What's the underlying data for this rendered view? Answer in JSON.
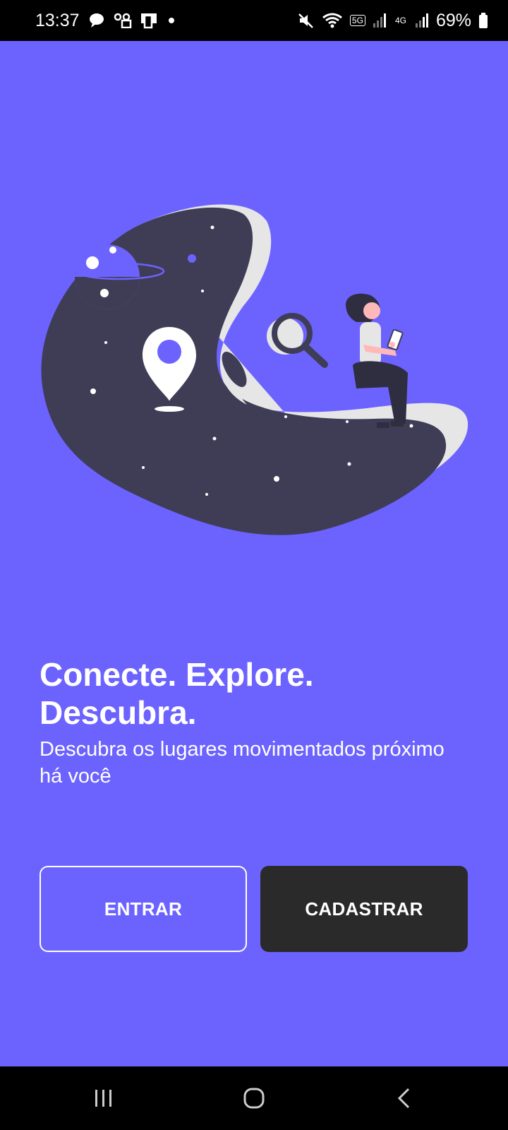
{
  "status_bar": {
    "time": "13:37",
    "battery_percent": "69%",
    "network_5g": "5G",
    "network_4g": "4G",
    "icons": [
      "chat-icon",
      "voicemail-icon",
      "screen-icon",
      "dot-icon",
      "mute-icon",
      "wifi-icon",
      "signal-icon",
      "battery-icon"
    ]
  },
  "hero": {
    "illustration": "location-search-illustration"
  },
  "onboarding": {
    "headline": "Conecte. Explore. Descubra.",
    "subtitle": "Descubra os lugares movimentados próximo há você"
  },
  "actions": {
    "login_label": "ENTRAR",
    "signup_label": "CADASTRAR"
  },
  "nav_bar": {
    "icons": [
      "recents-icon",
      "home-icon",
      "back-icon"
    ]
  },
  "colors": {
    "background": "#6c63ff",
    "blob": "#3f3d56",
    "button_dark": "#2a2a2a",
    "accent_light": "#e6e6e6"
  }
}
